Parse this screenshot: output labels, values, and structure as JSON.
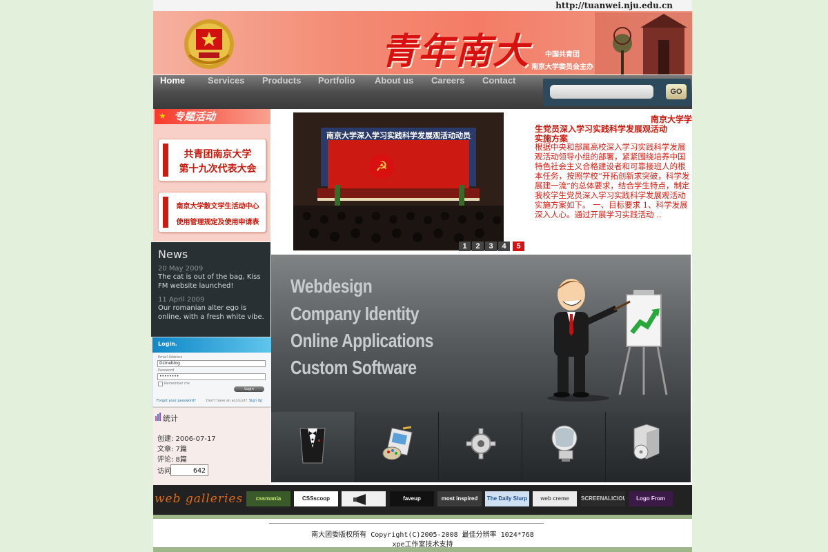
{
  "header": {
    "url": "http://tuanwei.nju.edu.cn",
    "site_title": "青年南大",
    "subtitle_line1": "中国共青团",
    "subtitle_line2": "南京大学委员会主办"
  },
  "nav": {
    "items": [
      {
        "label": "Home",
        "active": true
      },
      {
        "label": "Services"
      },
      {
        "label": "Products"
      },
      {
        "label": "Portfolio"
      },
      {
        "label": "About us"
      },
      {
        "label": "Careers"
      },
      {
        "label": "Contact"
      }
    ],
    "search_button": "GO"
  },
  "sidebar": {
    "special_heading": "专题活动",
    "promo1_line1": "共青团南京大学",
    "promo1_line2": "第十九次代表大会",
    "promo2_line1": "南京大学散文学生活动中心",
    "promo2_line2": "使用管理规定及使用申请表"
  },
  "news": {
    "heading": "News",
    "items": [
      {
        "date": "20 May 2009",
        "text": "The cat is out of the bag, Kiss FM website launched!"
      },
      {
        "date": "11 April 2009",
        "text": "Our romanian alter ego is online, with a fresh white vibe."
      }
    ]
  },
  "login": {
    "title": "Login.",
    "email_label": "Email Address",
    "email_value": "Dzineblog",
    "password_label": "Password",
    "password_value": "••••••••",
    "remember": "Remember me",
    "button": "Login",
    "forgot": "Forgot your password?",
    "no_account": "Don't have an account?",
    "signup": "Sign Up"
  },
  "stats": {
    "title": "统计",
    "created": "创建: 2006-07-17",
    "articles": "文章: 7篇",
    "comments": "评论: 8篇",
    "visits_label": "访问:",
    "visits": "642"
  },
  "feature": {
    "photo_banner": "南京大学深入学习实践科学发展观活动动员大会",
    "slides": [
      "1",
      "2",
      "3",
      "4",
      "5"
    ],
    "active_slide": "5",
    "title_line1": "南京大学学",
    "title_line2": "生党员深入学习实践科学发展观活动",
    "title_line3": "实施方案",
    "body": "根据中央和部属高校深入学习实践科学发展观活动领导小组的部署，紧紧围绕培养中国特色社会主义合格建设者和可靠接班人的根本任务，按照学校“开拓创新求突破，科学发展建一流”的总体要求，结合学生特点，制定我校学生党员深入学习实践科学发展观活动实施方案如下。 一、目标要求 1、科学发展深入人心。通过开展学习实践活动 .."
  },
  "showcase": {
    "services": [
      "Webdesign",
      "Company Identity",
      "Online Applications",
      "Custom Software"
    ]
  },
  "galleries": {
    "label": "web galleries",
    "sites": [
      {
        "label": "cssmania",
        "bg": "#3a5a2a",
        "fg": "#c8e870"
      },
      {
        "label": "CSSscoop",
        "bg": "#ffffff",
        "fg": "#222222"
      },
      {
        "label": "",
        "bg": "#f0f0f0",
        "fg": "#222222"
      },
      {
        "label": "faveup",
        "bg": "#111111",
        "fg": "#ffffff"
      },
      {
        "label": "most inspired",
        "bg": "#3a3a3a",
        "fg": "#ffffff"
      },
      {
        "label": "The Daily Slurp",
        "bg": "#cfe0f2",
        "fg": "#1a4f8c"
      },
      {
        "label": "web creme",
        "bg": "#ececec",
        "fg": "#555555"
      },
      {
        "label": "SCREENALICIOUS",
        "bg": "#2a2a2a",
        "fg": "#cccccc"
      },
      {
        "label": "Logo From Dreams Awards",
        "bg": "#3b1a48",
        "fg": "#f0d0ff"
      }
    ]
  },
  "footer": {
    "copyright": "南大团委版权所有 Copyright(C)2005-2008 最佳分辨率 1024*768",
    "support": "xpe工作室技术支持"
  },
  "colors": {
    "accent_red": "#d81010",
    "nav_dark": "#3a3a3a",
    "background_green": "#e3f1dc"
  }
}
